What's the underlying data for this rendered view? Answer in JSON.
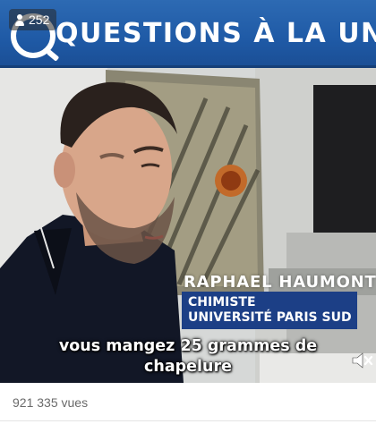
{
  "video": {
    "viewer_count": "252",
    "banner_title": "QUESTIONS À LA UNE",
    "person_name": "RAPHAEL HAUMONT",
    "role_line1": "CHIMISTE",
    "role_line2": "UNIVERSITÉ PARIS SUD",
    "subtitle_line1": "vous mangez 25 grammes de",
    "subtitle_line2": "chapelure",
    "viewer_icon": "person-icon",
    "sound_icon": "speaker-muted-icon"
  },
  "post": {
    "views_text": "921 335 vues"
  },
  "colors": {
    "banner_blue": "#1f5aa6",
    "role_box_blue": "#1c3f86",
    "views_text_gray": "#6a6a6a"
  }
}
